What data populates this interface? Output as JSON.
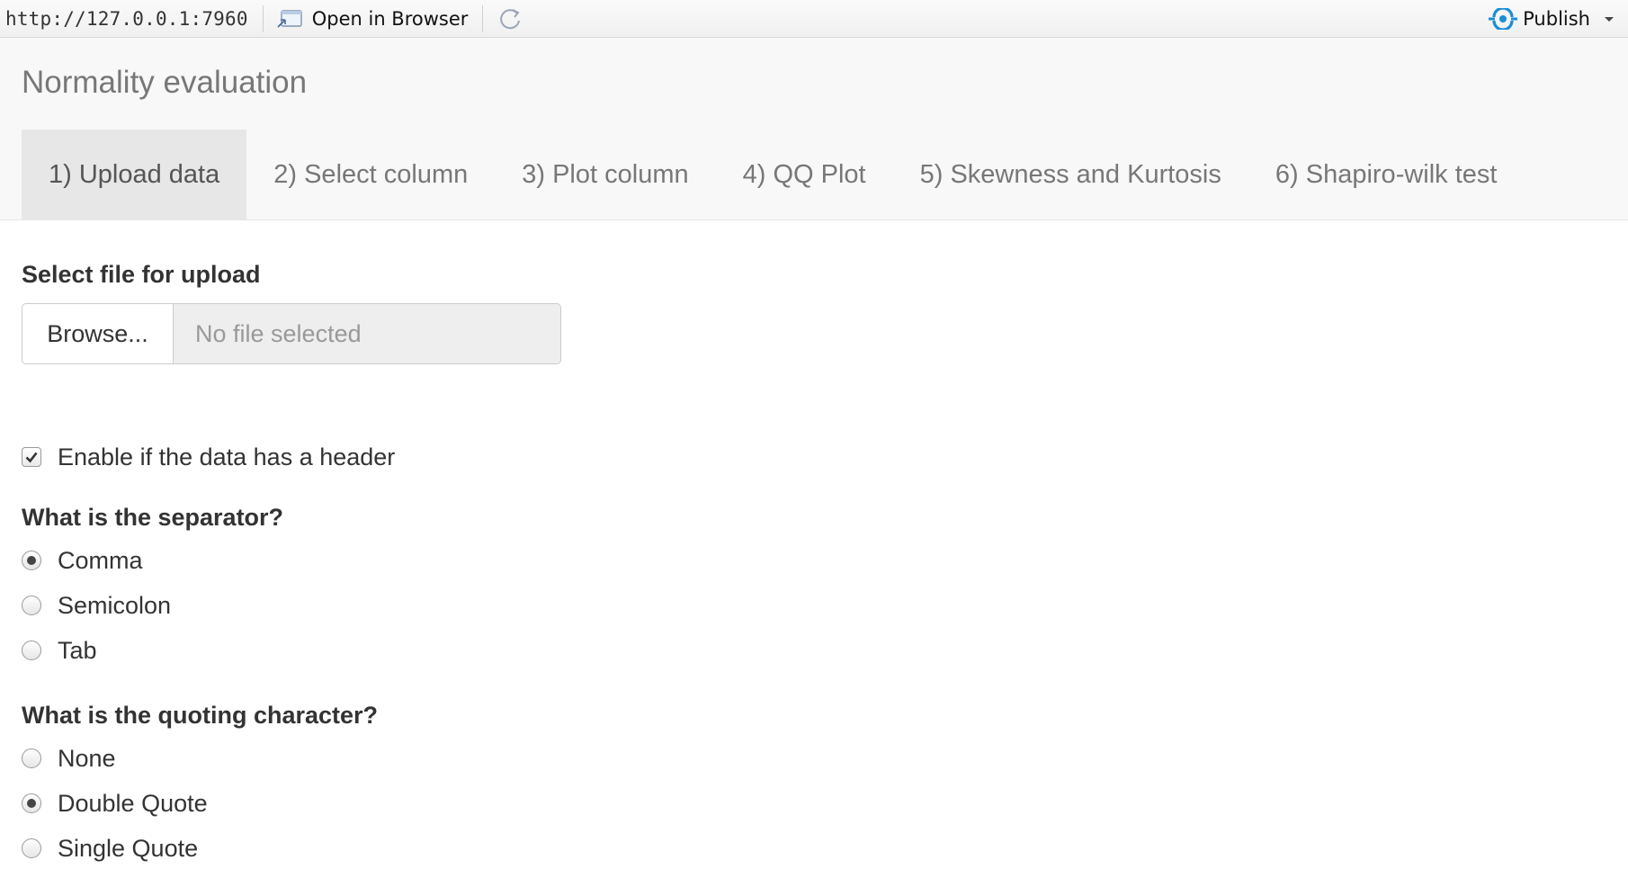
{
  "toolbar": {
    "url": "http://127.0.0.1:7960",
    "open_in_browser_label": "Open in Browser",
    "publish_label": "Publish",
    "icons": {
      "open_browser": "open-in-browser-icon",
      "refresh": "refresh-icon",
      "publish": "publish-icon",
      "dropdown": "chevron-down-icon"
    },
    "publish_color": "#1a8fd6"
  },
  "header": {
    "title": "Normality evaluation"
  },
  "tabs": [
    {
      "label": "1) Upload data",
      "active": true
    },
    {
      "label": "2) Select column",
      "active": false
    },
    {
      "label": "3) Plot column",
      "active": false
    },
    {
      "label": "4) QQ Plot",
      "active": false
    },
    {
      "label": "5) Skewness and Kurtosis",
      "active": false
    },
    {
      "label": "6) Shapiro-wilk test",
      "active": false
    }
  ],
  "upload": {
    "label": "Select file for upload",
    "browse_label": "Browse...",
    "file_status": "No file selected"
  },
  "header_option": {
    "label": "Enable if the data has a header",
    "checked": true
  },
  "separator": {
    "label": "What is the separator?",
    "options": [
      {
        "label": "Comma",
        "selected": true
      },
      {
        "label": "Semicolon",
        "selected": false
      },
      {
        "label": "Tab",
        "selected": false
      }
    ]
  },
  "quote": {
    "label": "What is the quoting character?",
    "options": [
      {
        "label": "None",
        "selected": false
      },
      {
        "label": "Double Quote",
        "selected": true
      },
      {
        "label": "Single Quote",
        "selected": false
      }
    ]
  }
}
